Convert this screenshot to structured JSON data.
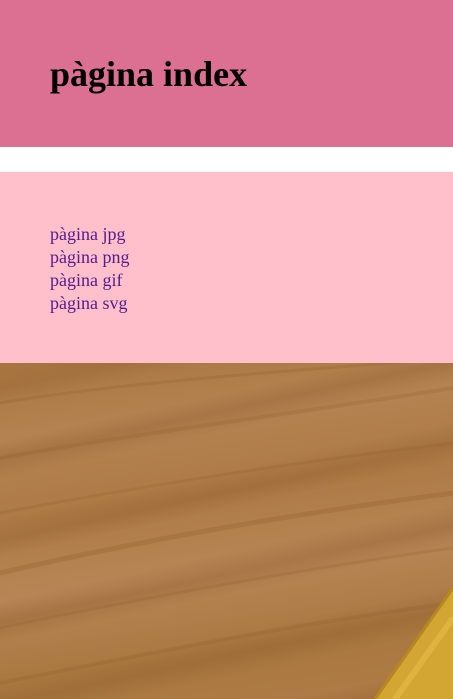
{
  "header": {
    "title": "pàgina index",
    "background_color": "#db7093"
  },
  "nav": {
    "background_color": "#ffc0cb",
    "link_color": "#551a8b",
    "links": [
      {
        "label": "pàgina jpg"
      },
      {
        "label": "pàgina png"
      },
      {
        "label": "pàgina gif"
      },
      {
        "label": "pàgina svg"
      }
    ]
  },
  "photo": {
    "subject": "wood grain with yellow object corner"
  }
}
